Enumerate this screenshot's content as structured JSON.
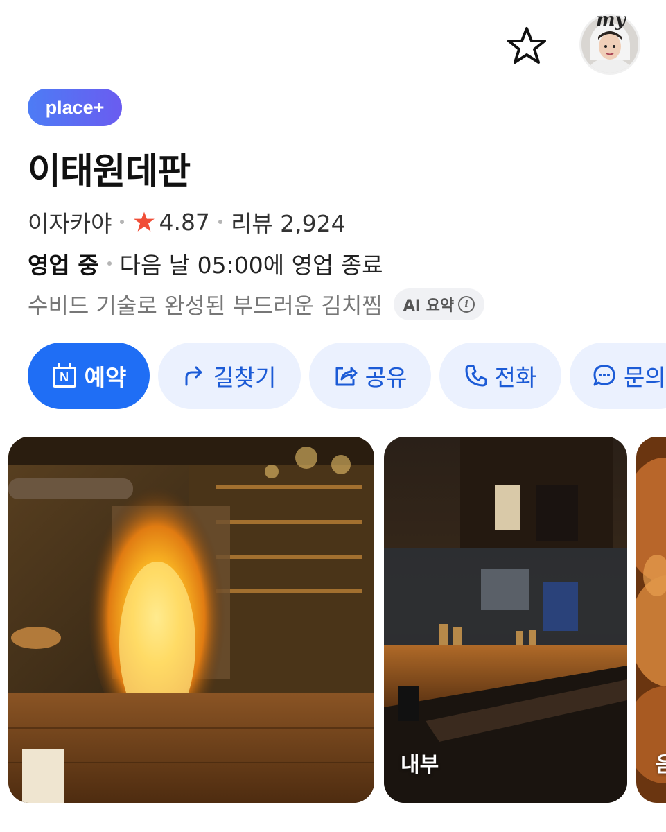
{
  "header": {
    "favorite_icon": "star-outline-icon",
    "profile_label": "my"
  },
  "place": {
    "badge": "place+",
    "name": "이태원데판",
    "category": "이자카야",
    "rating": "4.87",
    "review_label": "리뷰 2,924",
    "status": "영업 중",
    "hours_text": "다음 날 05:00에 영업 종료",
    "summary": "수비드 기술로 완성된 부드러운 김치찜",
    "ai_chip": "AI 요약"
  },
  "actions": [
    {
      "label": "예약",
      "icon": "naver-calendar-icon"
    },
    {
      "label": "길찾기",
      "icon": "directions-arrow-icon"
    },
    {
      "label": "공유",
      "icon": "share-icon"
    },
    {
      "label": "전화",
      "icon": "phone-icon"
    },
    {
      "label": "문의",
      "icon": "chat-bubble-icon"
    }
  ],
  "photos": [
    {
      "label": ""
    },
    {
      "label": "내부"
    },
    {
      "label": "음"
    }
  ],
  "colors": {
    "primary": "#1f6ef5",
    "action_bg": "#ebf1fe",
    "action_text": "#1c5bd6",
    "rating_star": "#f04e37"
  }
}
